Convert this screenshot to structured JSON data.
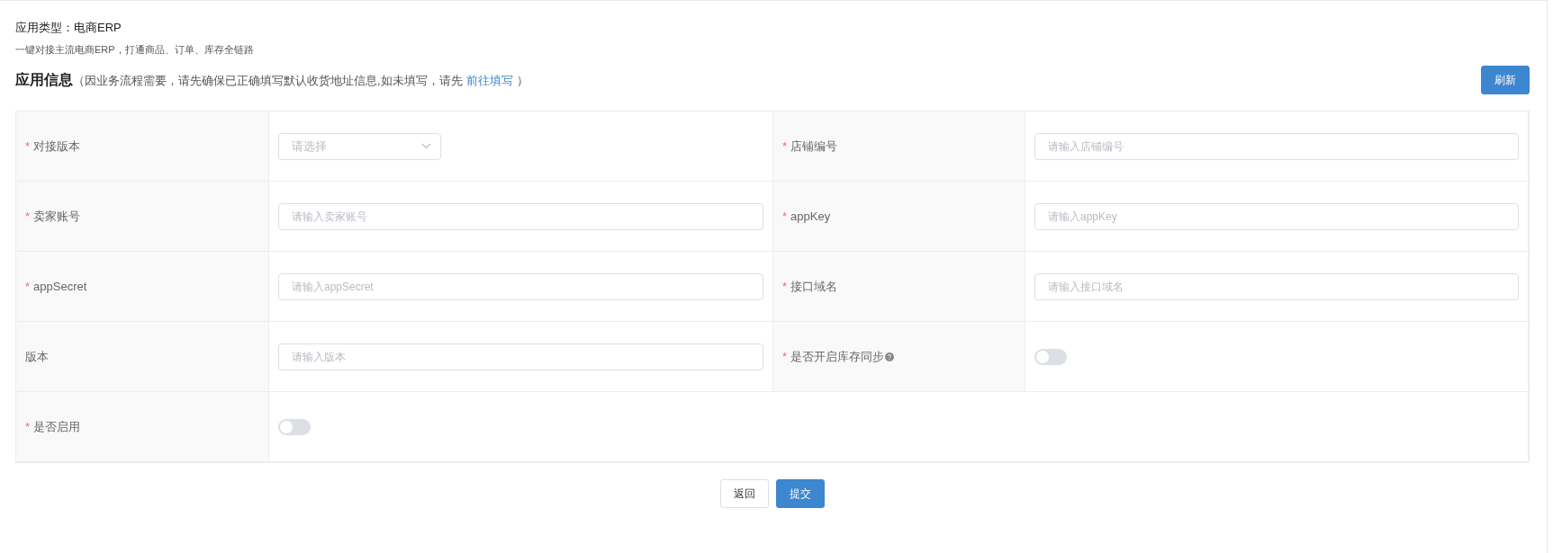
{
  "app_type": {
    "label": "应用类型：",
    "value": "电商ERP"
  },
  "subtitle": "一键对接主流电商ERP，打通商品、订单、库存全链路",
  "section": {
    "title": "应用信息",
    "note_before": "（因业务流程需要，请先确保已正确填写默认收货地址信息,如未填写，请先",
    "link": "前往填写",
    "note_after": "）",
    "refresh_button": "刷新"
  },
  "fields": [
    {
      "required_mark": "*",
      "label": "对接版本",
      "kind": "select",
      "placeholder": "请选择"
    },
    {
      "required_mark": "*",
      "label": "店铺编号",
      "kind": "input",
      "placeholder": "请输入店铺编号"
    },
    {
      "required_mark": "*",
      "label": "卖家账号",
      "kind": "input",
      "placeholder": "请输入卖家账号"
    },
    {
      "required_mark": "*",
      "label": "appKey",
      "kind": "input",
      "placeholder": "请输入appKey"
    },
    {
      "required_mark": "*",
      "label": "appSecret",
      "kind": "input",
      "placeholder": "请输入appSecret"
    },
    {
      "required_mark": "*",
      "label": "接口域名",
      "kind": "input",
      "placeholder": "请输入接口域名"
    },
    {
      "label": "版本",
      "kind": "input",
      "placeholder": "请输入版本"
    },
    {
      "required_mark": "*",
      "label": "是否开启库存同步",
      "kind": "switch",
      "help": true,
      "on": false
    },
    {
      "required_mark": "*",
      "label": "是否启用",
      "kind": "switch",
      "on": false
    }
  ],
  "buttons": [
    {
      "label": "返回",
      "kind": "secondary"
    },
    {
      "label": "提交",
      "kind": "primary"
    }
  ]
}
